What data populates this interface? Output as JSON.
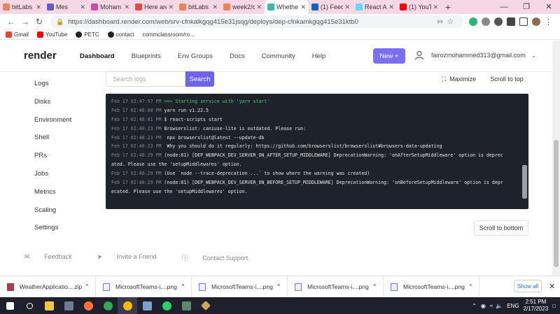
{
  "browser": {
    "tabs": [
      {
        "label": "bitLabs |",
        "color": "#e8845a"
      },
      {
        "label": "Mes",
        "color": "#5b5fc7"
      },
      {
        "label": "Moham",
        "color": "#c84ea8"
      },
      {
        "label": "Here are",
        "color": "#e24a4a"
      },
      {
        "label": "bitLabs |",
        "color": "#e8845a"
      },
      {
        "label": "week2/c",
        "color": "#e8845a"
      },
      {
        "label": "Whethe",
        "color": "#3bb8a8",
        "active": true
      },
      {
        "label": "(1) Feed",
        "color": "#0a66c2"
      },
      {
        "label": "React A",
        "color": "#61dafb"
      },
      {
        "label": "(1) YouT",
        "color": "#ff0000"
      }
    ],
    "url": "https://dashboard.render.com/web/srv-cfnkalkgqg415e31jsqg/deploys/dep-cfnkamkgqg415e31ktb0",
    "bookmarks": [
      "Gmail",
      "YouTube",
      "PETC",
      "contact",
      "commclassroom/ro..."
    ]
  },
  "header": {
    "logo": "render",
    "nav": [
      "Dashboard",
      "Blueprints",
      "Env Groups",
      "Docs",
      "Community",
      "Help"
    ],
    "new_label": "New +",
    "user_email": "fairozmohammed313@gmail.com"
  },
  "sidebar": [
    "Logs",
    "Disks",
    "Environment",
    "Shell",
    "PRs",
    "Jobs",
    "Metrics",
    "Scaling",
    "Settings"
  ],
  "logs": {
    "search_placeholder": "Search logs",
    "search_label": "Search",
    "maximize_label": "Maximize",
    "scroll_top_label": "Scroll to top",
    "scroll_bottom_label": "Scroll to bottom",
    "lines": [
      {
        "ts": "Feb 17 02:47:57 PM",
        "msg": "==> Starting service with 'yarn start'"
      },
      {
        "ts": "Feb 17 02:48:00 PM",
        "msg": "yarn run v1.22.5"
      },
      {
        "ts": "Feb 17 02:48:01 PM",
        "msg": "$ react-scripts start"
      },
      {
        "ts": "Feb 17 02:48:23 PM",
        "msg": "Browserslist: caniuse-lite is outdated. Please run:"
      },
      {
        "ts": "Feb 17 02:48:23 PM",
        "msg": "  npx browserslist@latest --update-db"
      },
      {
        "ts": "Feb 17 02:48:23 PM",
        "msg": "  Why you should do it regularly: https://github.com/browserslist/browserslist#browsers-data-updating"
      },
      {
        "ts": "Feb 17 02:48:29 PM",
        "msg": "(node:81) [DEP_WEBPACK_DEV_SERVER_ON_AFTER_SETUP_MIDDLEWARE] DeprecationWarning: 'onAfterSetupMiddleware' option is deprec",
        "cont": "ated. Please use the 'setupMiddlewares' option."
      },
      {
        "ts": "Feb 17 02:48:29 PM",
        "msg": "(Use `node --trace-deprecation ...` to show where the warning was created)"
      },
      {
        "ts": "Feb 17 02:48:29 PM",
        "msg": "(node:81) [DEP_WEBPACK_DEV_SERVER_ON_BEFORE_SETUP_MIDDLEWARE] DeprecationWarning: 'onBeforeSetupMiddleware' option is depr",
        "cont": "ecated. Please use the 'setupMiddlewares' option."
      }
    ]
  },
  "footer": [
    "Feedback",
    "Invite a Friend",
    "Contact Support"
  ],
  "downloads": {
    "items": [
      "WeatherApplicatio....zip",
      "MicrosoftTeams-i....png",
      "MicrosoftTeams-i....png",
      "MicrosoftTeams-i....png",
      "MicrosoftTeams-i....png"
    ],
    "show_all": "Show all"
  },
  "taskbar": {
    "time": "2:51 PM",
    "date": "2/17/2023",
    "lang": "ENG"
  }
}
